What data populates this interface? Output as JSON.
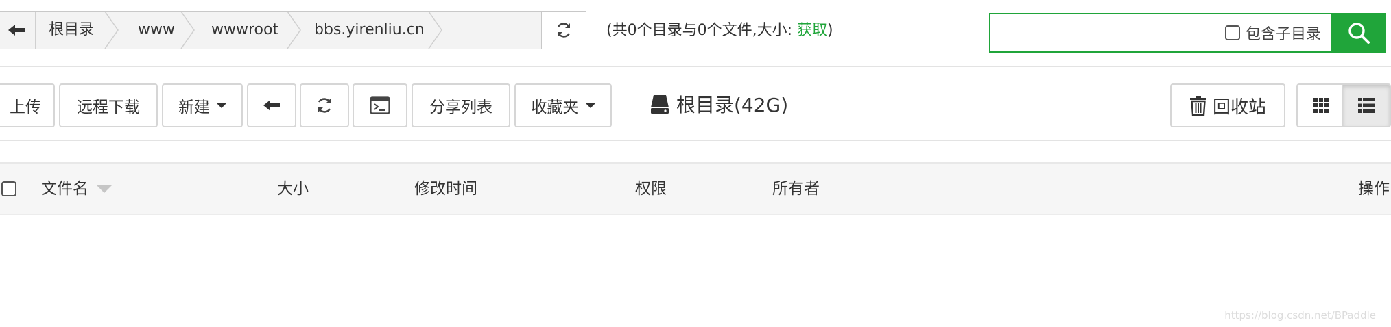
{
  "breadcrumb": {
    "items": [
      "根目录",
      "www",
      "wwwroot",
      "bbs.yirenliu.cn"
    ]
  },
  "summary": {
    "prefix": "(共0个目录与0个文件,大小: ",
    "link": "获取",
    "suffix": ")"
  },
  "search": {
    "placeholder": "",
    "include_subdir_label": "包含子目录"
  },
  "toolbar": {
    "upload": "上传",
    "remote_download": "远程下载",
    "new": "新建",
    "share_list": "分享列表",
    "favorites": "收藏夹",
    "disk_label": "根目录(42G)",
    "recycle_bin": "回收站"
  },
  "table": {
    "columns": {
      "name": "文件名",
      "size": "大小",
      "modified": "修改时间",
      "permission": "权限",
      "owner": "所有者",
      "actions": "操作"
    }
  },
  "watermark": "https://blog.csdn.net/BPaddle",
  "colors": {
    "accent": "#20a53a"
  },
  "icons": [
    "back-arrow-icon",
    "refresh-icon",
    "search-icon",
    "terminal-icon",
    "disk-icon",
    "trash-icon",
    "grid-view-icon",
    "list-view-icon"
  ]
}
